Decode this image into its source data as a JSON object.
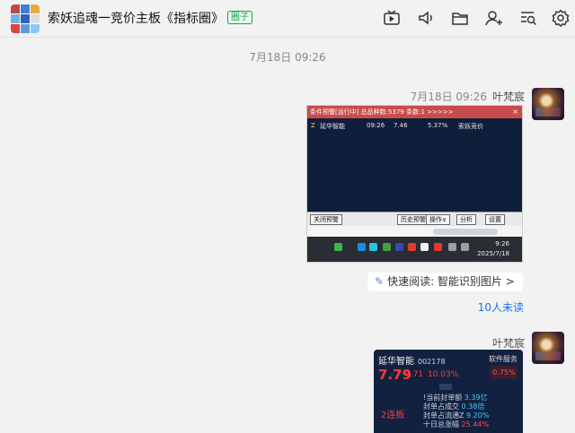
{
  "header": {
    "title": "索妖追魂一竞价主板《指标圈》",
    "badge": "圈子",
    "icons": [
      "tv-icon",
      "speaker-icon",
      "folder-icon",
      "add-user-icon",
      "search-list-icon",
      "gear-icon"
    ]
  },
  "chat": {
    "center_time": "7月18日 09:26",
    "msg1": {
      "time": "7月18日 09:26",
      "sender": "叶梵宸"
    },
    "screenshot": {
      "title": "条件预警[运行中] 总品种数:5379 条数:1  >>>>>",
      "close": "×",
      "row": {
        "marker": "Z",
        "name": "延华智能",
        "time": "09:26",
        "price": "7.46",
        "pct": "5.37%",
        "rule": "索妖竞价"
      },
      "buttons": {
        "close_warn": "关闭预警",
        "history": "历史预警",
        "op": "操作∨",
        "analyze": "分析",
        "settings": "设置"
      },
      "taskbar_time": "9:26",
      "taskbar_date": "2025/7/18"
    },
    "quick_read": {
      "icon": "sparkle-icon",
      "label": "快速阅读: 智能识别图片 >"
    },
    "unread": "10人未读",
    "msg2": {
      "sender": "叶梵宸"
    },
    "stock_card": {
      "name": "延华智能",
      "code": "002178",
      "tag": "软件服务",
      "price": "7.79",
      "change": "0.71",
      "pct": "10.03%",
      "box": "0.75%",
      "lianban": "2连板",
      "stats": [
        {
          "label": "!当前封单额",
          "value": "3.39亿"
        },
        {
          "label": "封单占成交",
          "value": "0.38倍"
        },
        {
          "label": "封单占流通Z",
          "value": "9.20%"
        },
        {
          "label": "十日总涨幅",
          "value": "25.44%"
        }
      ]
    }
  },
  "colors": {
    "accent_link": "#1a73e8",
    "badge_green": "#07a44a",
    "stock_red": "#ff3b3b",
    "card_bg": "#12213f"
  }
}
